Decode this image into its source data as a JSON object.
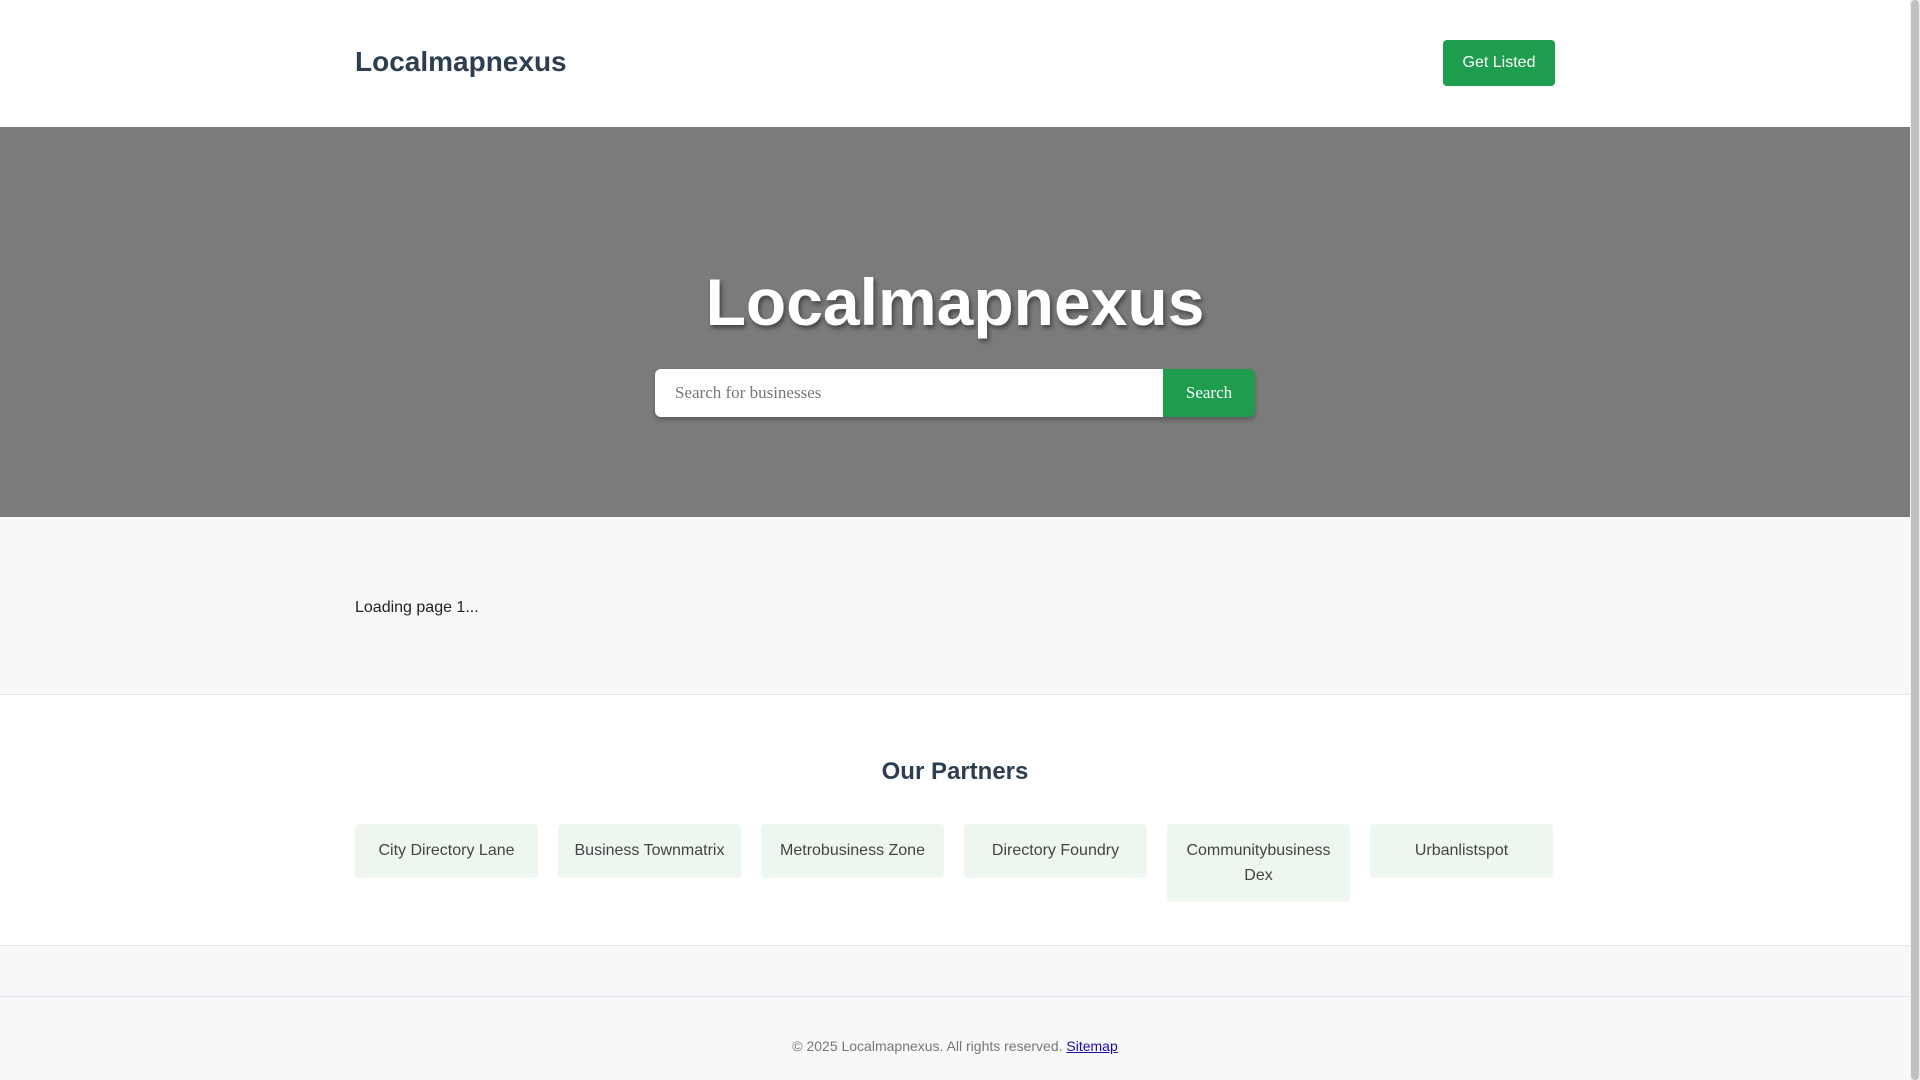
{
  "header": {
    "brand": "Localmapnexus",
    "cta_label": "Get Listed"
  },
  "hero": {
    "title": "Localmapnexus",
    "search": {
      "placeholder": "Search for businesses",
      "value": "",
      "button_label": "Search"
    }
  },
  "listing": {
    "status_text": "Loading page 1..."
  },
  "partners": {
    "title": "Our Partners",
    "items": [
      {
        "label": "City Directory Lane"
      },
      {
        "label": "Business Townmatrix"
      },
      {
        "label": "Metrobusiness Zone"
      },
      {
        "label": "Directory Foundry"
      },
      {
        "label": "Communitybusiness Dex"
      },
      {
        "label": "Urbanlistspot"
      }
    ]
  },
  "footer": {
    "copyright": "© 2025 Localmapnexus. All rights reserved.",
    "sitemap_label": "Sitemap"
  },
  "colors": {
    "accent": "#1f9d4f",
    "hero_bg": "#7b7b7b",
    "brand_text": "#2c3e50",
    "partner_card_bg": "#eef6f0",
    "link": "#1a0dab"
  }
}
